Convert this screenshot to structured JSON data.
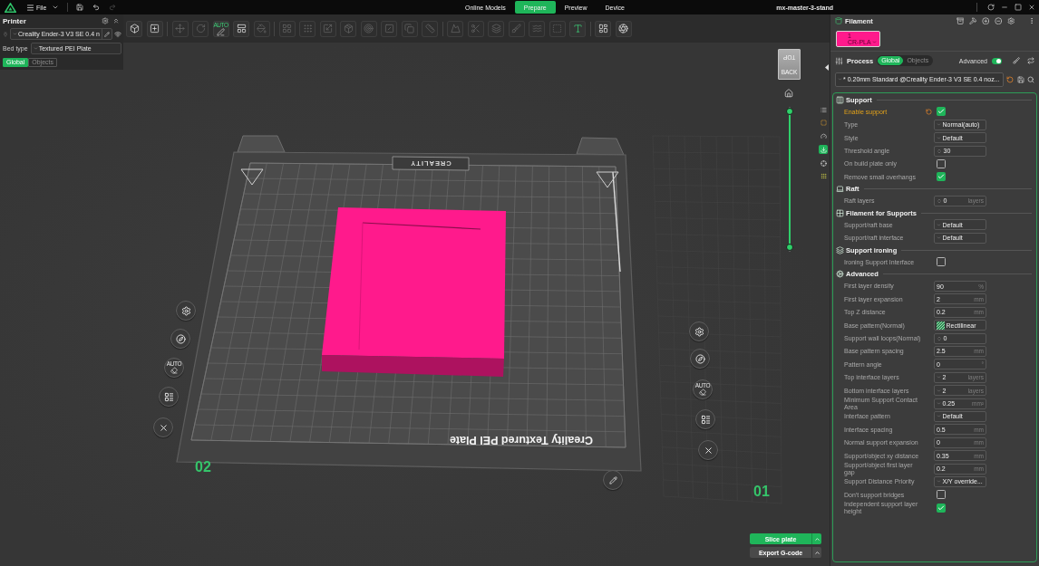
{
  "title_bar": {
    "menu": "File",
    "undo_disabled": false,
    "redo_disabled": true,
    "tabs": [
      {
        "label": "Online Models",
        "selected": false
      },
      {
        "label": "Prepare",
        "selected": true
      },
      {
        "label": "Preview",
        "selected": false
      },
      {
        "label": "Device",
        "selected": false
      }
    ],
    "project": "mx-master-3-stand"
  },
  "printer": {
    "title": "Printer",
    "model": "Creality Ender-3 V3 SE 0.4 n",
    "bed_type_label": "Bed type",
    "bed_type": "Textured PEI Plate",
    "scope": [
      {
        "label": "Global",
        "selected": true
      },
      {
        "label": "Objects",
        "selected": false
      }
    ]
  },
  "toolbar": {
    "groups": [
      [
        {
          "disabled": false
        },
        {
          "disabled": false
        }
      ],
      [
        {
          "disabled": true
        },
        {
          "disabled": true
        },
        {
          "disabled": false,
          "label": "AUTO"
        },
        {
          "disabled": false
        },
        {
          "disabled": true
        }
      ],
      [
        {
          "disabled": true
        },
        {
          "disabled": true
        },
        {
          "disabled": true
        },
        {
          "disabled": true
        },
        {
          "disabled": true
        },
        {
          "disabled": true
        },
        {
          "disabled": true
        },
        {
          "disabled": true
        }
      ],
      [
        {
          "disabled": true
        },
        {
          "disabled": true
        },
        {
          "disabled": true
        },
        {
          "disabled": true
        },
        {
          "disabled": true
        },
        {
          "disabled": true
        },
        {
          "disabled": false
        }
      ],
      [
        {
          "disabled": false
        },
        {
          "disabled": false
        }
      ]
    ]
  },
  "scene": {
    "bed_logo": "CREALITY",
    "plate_label": "Creality Textured PEI Plate",
    "plates": [
      {
        "number": "02",
        "arrange_label": "AUTO"
      },
      {
        "number": "01",
        "arrange_label": "AUTO"
      }
    ],
    "view_cube": {
      "top": "TOP",
      "side": "BACK"
    },
    "layer_slider": {
      "level": 1
    },
    "side_tools": [
      {
        "selected": false
      },
      {
        "selected": false
      },
      {
        "selected": false
      },
      {
        "selected": true
      },
      {
        "selected": false
      },
      {
        "selected": false
      }
    ],
    "slice_button": "Slice plate",
    "export_button": "Export G-code"
  },
  "filament": {
    "title": "Filament",
    "items": [
      {
        "index": "1",
        "name": "CR-PLA",
        "color": "#ff1a8c"
      }
    ]
  },
  "process": {
    "title": "Process",
    "scope": [
      {
        "label": "Global",
        "selected": true
      },
      {
        "label": "Objects",
        "selected": false
      }
    ],
    "advanced_label": "Advanced",
    "advanced_on": true,
    "preset": "* 0.20mm Standard @Creality Ender-3 V3 SE 0.4 noz...",
    "sections": [
      {
        "title": "Support",
        "rows": [
          {
            "label": "Enable support",
            "kind": "checkbox",
            "checked": true,
            "modified": true
          },
          {
            "label": "Type",
            "kind": "select",
            "value": "Normal(auto)",
            "modified": false
          },
          {
            "label": "Style",
            "kind": "select",
            "value": "Default",
            "modified": false
          },
          {
            "label": "Threshold angle",
            "kind": "spin",
            "value": "30",
            "modified": false
          },
          {
            "label": "On build plate only",
            "kind": "checkbox",
            "checked": false,
            "modified": false
          },
          {
            "label": "Remove small overhangs",
            "kind": "checkbox",
            "checked": true,
            "modified": false
          }
        ]
      },
      {
        "title": "Raft",
        "rows": [
          {
            "label": "Raft layers",
            "kind": "spin",
            "value": "0",
            "unit": "layers",
            "modified": false
          }
        ]
      },
      {
        "title": "Filament for Supports",
        "rows": [
          {
            "label": "Support/raft base",
            "kind": "select",
            "value": "Default",
            "modified": false
          },
          {
            "label": "Support/raft interface",
            "kind": "select",
            "value": "Default",
            "modified": false
          }
        ]
      },
      {
        "title": "Support ironing",
        "rows": [
          {
            "label": "Ironing Support Interface",
            "kind": "checkbox",
            "checked": false,
            "modified": false
          }
        ]
      },
      {
        "title": "Advanced",
        "rows": [
          {
            "label": "First layer density",
            "kind": "input",
            "value": "90",
            "unit": "%",
            "modified": false
          },
          {
            "label": "First layer expansion",
            "kind": "input",
            "value": "2",
            "unit": "mm",
            "modified": false
          },
          {
            "label": "Top Z distance",
            "kind": "input",
            "value": "0.2",
            "unit": "mm",
            "modified": false
          },
          {
            "label": "Base pattern(Normal)",
            "kind": "pattern",
            "value": "Rectilinear",
            "modified": false
          },
          {
            "label": "Support wall loops(Normal)",
            "kind": "spin",
            "value": "0",
            "modified": false
          },
          {
            "label": "Base pattern spacing",
            "kind": "input",
            "value": "2.5",
            "unit": "mm",
            "modified": false
          },
          {
            "label": "Pattern angle",
            "kind": "input",
            "value": "0",
            "unit": "°",
            "modified": false
          },
          {
            "label": "Top interface layers",
            "kind": "combo",
            "value": "2",
            "unit": "layers",
            "modified": false
          },
          {
            "label": "Bottom interface layers",
            "kind": "combo",
            "value": "2",
            "unit": "layers",
            "modified": false
          },
          {
            "label": "Minimum Support Contact Area",
            "kind": "combo",
            "value": "0.25",
            "unit": "mm²",
            "modified": false
          },
          {
            "label": "Interface pattern",
            "kind": "select",
            "value": "Default",
            "modified": false
          },
          {
            "label": "Interface spacing",
            "kind": "input",
            "value": "0.5",
            "unit": "mm",
            "modified": false
          },
          {
            "label": "Normal support expansion",
            "kind": "input",
            "value": "0",
            "unit": "mm",
            "modified": false
          },
          {
            "label": "Support/object xy distance",
            "kind": "input",
            "value": "0.35",
            "unit": "mm",
            "modified": false
          },
          {
            "label": "Support/object first layer gap",
            "kind": "input",
            "value": "0.2",
            "unit": "mm",
            "modified": false
          },
          {
            "label": "Support Distance Priority",
            "kind": "select",
            "value": "X/Y override...",
            "modified": false
          },
          {
            "label": "Don't support bridges",
            "kind": "checkbox",
            "checked": false,
            "modified": false
          },
          {
            "label": "Independent support layer height",
            "kind": "checkbox",
            "checked": true,
            "modified": false
          }
        ]
      }
    ]
  }
}
